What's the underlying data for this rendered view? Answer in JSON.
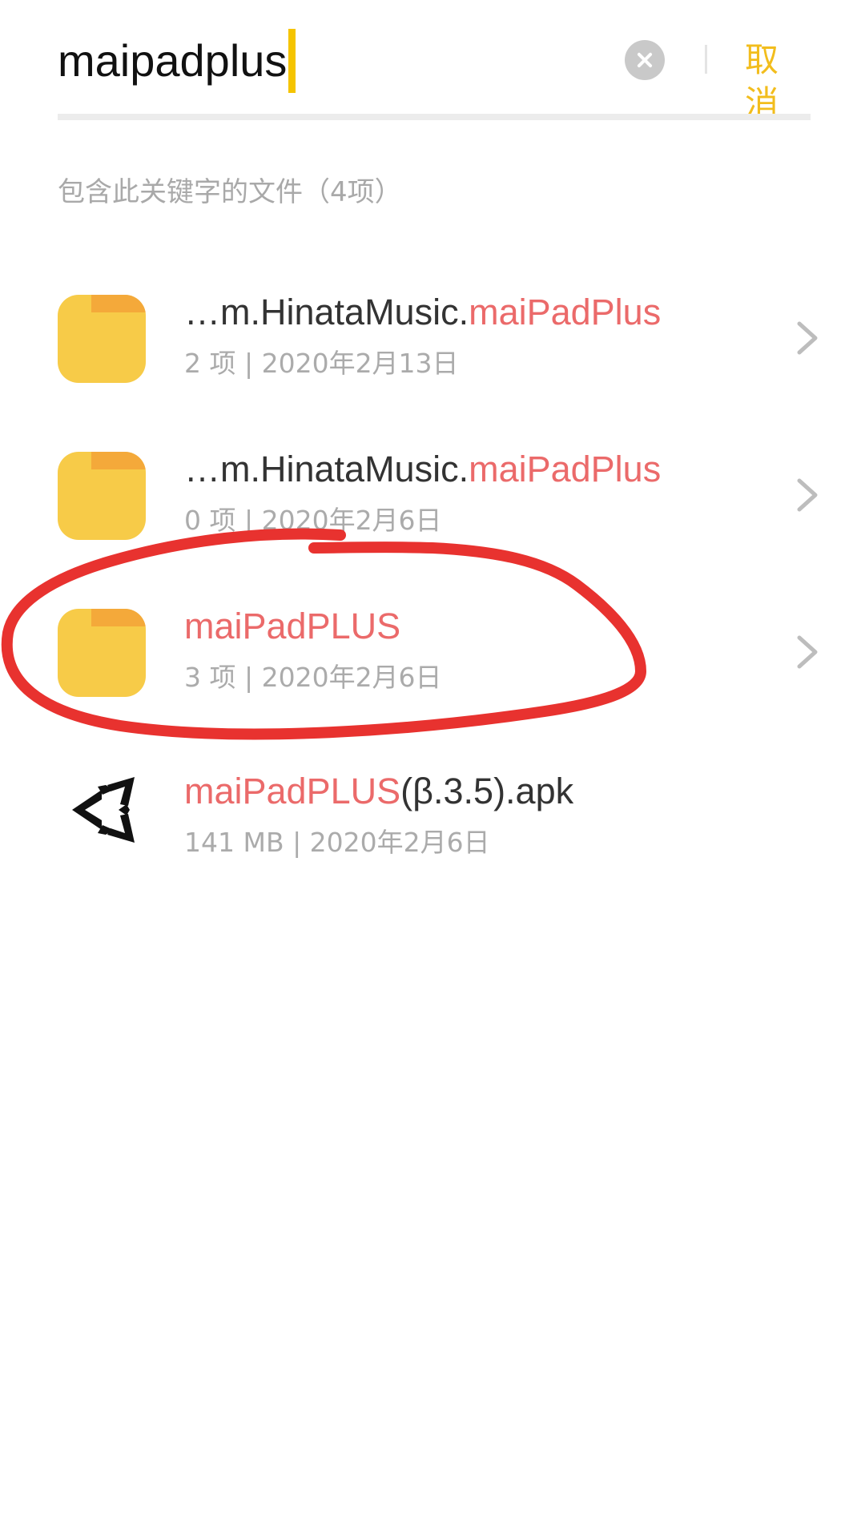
{
  "search": {
    "query": "maipadplus",
    "cancel_label": "取消"
  },
  "results_header": "包含此关键字的文件（4项）",
  "results": [
    {
      "title_prefix": "…m.HinataMusic.",
      "title_match": "maiPadPlus",
      "title_suffix": "",
      "meta": "2 项 | 2020年2月13日",
      "icon": "folder-icon"
    },
    {
      "title_prefix": "…m.HinataMusic.",
      "title_match": "maiPadPlus",
      "title_suffix": "",
      "meta": "0 项 | 2020年2月6日",
      "icon": "folder-icon"
    },
    {
      "title_prefix": "",
      "title_match": "maiPadPLUS",
      "title_suffix": "",
      "meta": "3 项 | 2020年2月6日",
      "icon": "folder-icon"
    },
    {
      "title_prefix": "",
      "title_match": "maiPadPLUS",
      "title_suffix": "(β.3.5).apk",
      "meta": "141 MB | 2020年2月6日",
      "icon": "unity-apk-icon"
    }
  ],
  "colors": {
    "accent": "#f2bd1d",
    "highlight": "#eb6a6a",
    "folder": "#f7cb48",
    "annotation": "#e8322f"
  }
}
